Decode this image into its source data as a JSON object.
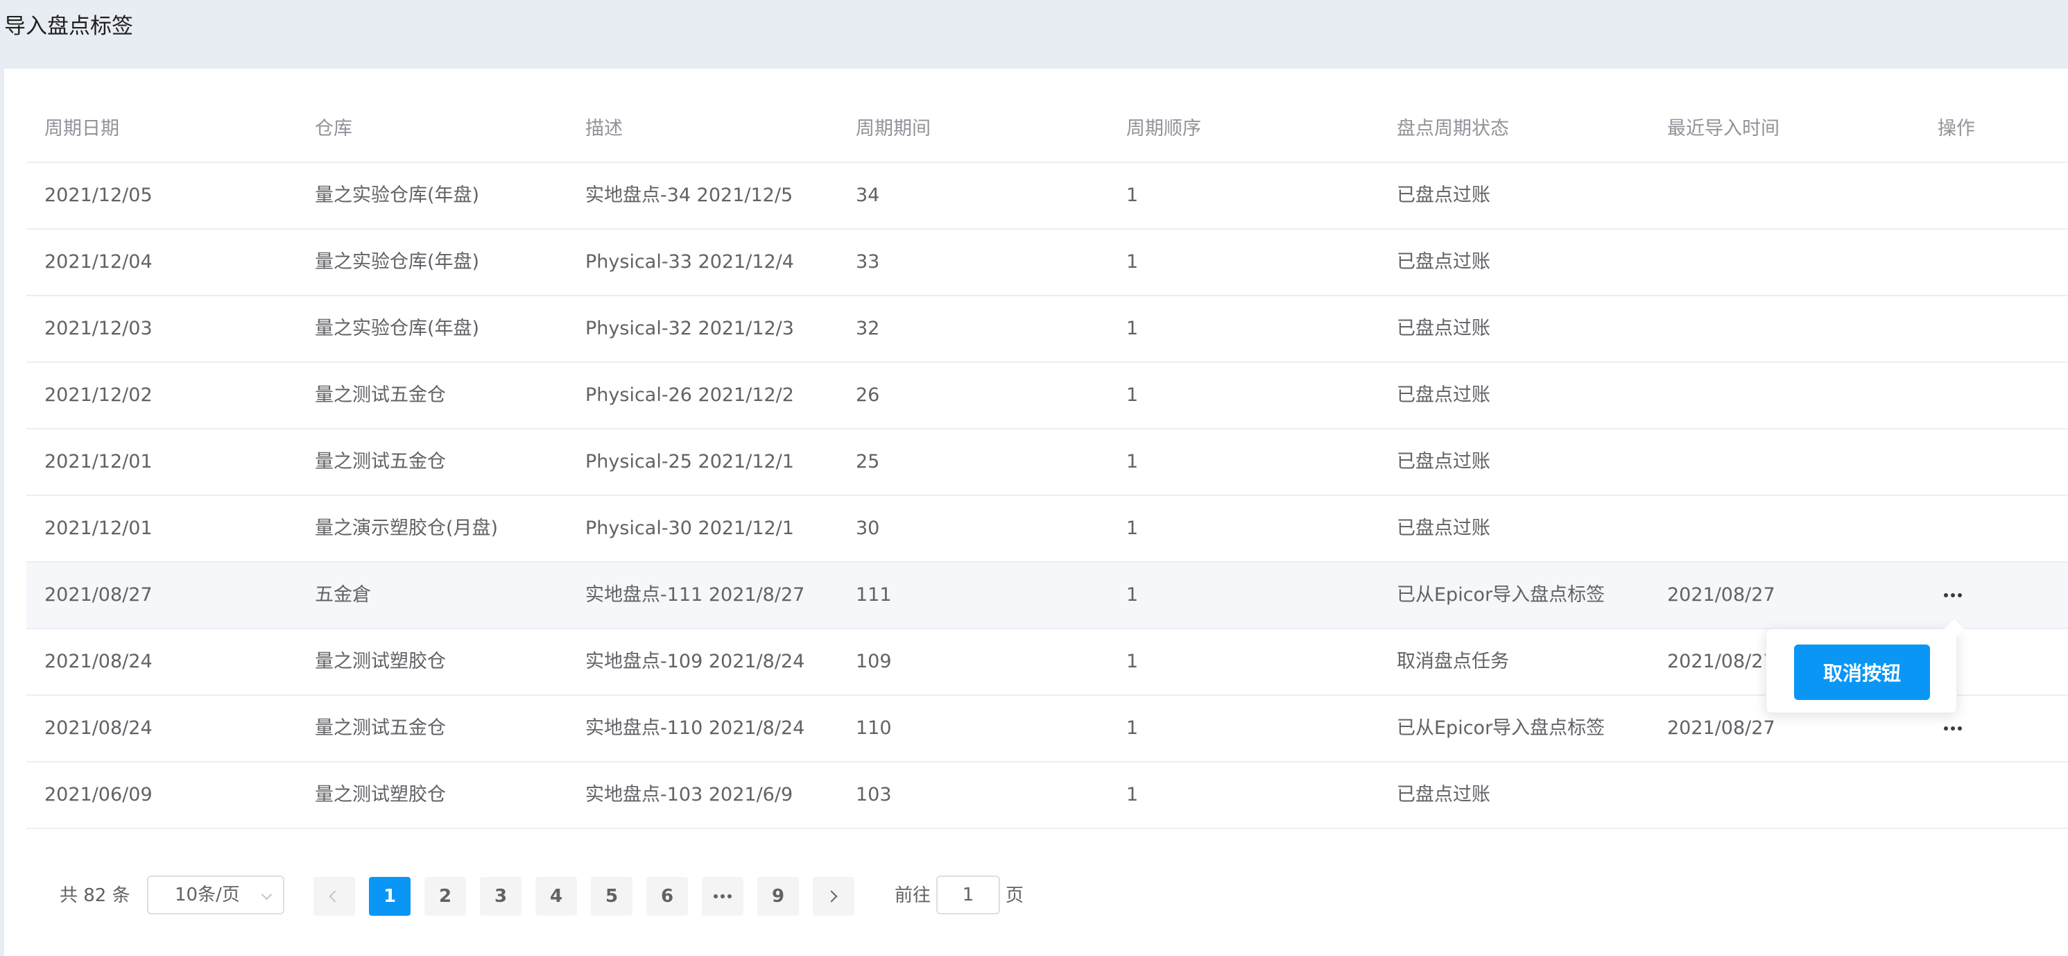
{
  "page": {
    "title": "导入盘点标签"
  },
  "table": {
    "columns": [
      "周期日期",
      "仓库",
      "描述",
      "周期期间",
      "周期顺序",
      "盘点周期状态",
      "最近导入时间",
      "操作"
    ],
    "rows": [
      {
        "date": "2021/12/05",
        "warehouse": "量之实验仓库(年盘)",
        "desc": "实地盘点-34 2021/12/5",
        "period": "34",
        "seq": "1",
        "status": "已盘点过账",
        "import_time": "",
        "has_action": false
      },
      {
        "date": "2021/12/04",
        "warehouse": "量之实验仓库(年盘)",
        "desc": "Physical-33 2021/12/4",
        "period": "33",
        "seq": "1",
        "status": "已盘点过账",
        "import_time": "",
        "has_action": false
      },
      {
        "date": "2021/12/03",
        "warehouse": "量之实验仓库(年盘)",
        "desc": "Physical-32 2021/12/3",
        "period": "32",
        "seq": "1",
        "status": "已盘点过账",
        "import_time": "",
        "has_action": false
      },
      {
        "date": "2021/12/02",
        "warehouse": "量之测试五金仓",
        "desc": "Physical-26 2021/12/2",
        "period": "26",
        "seq": "1",
        "status": "已盘点过账",
        "import_time": "",
        "has_action": false
      },
      {
        "date": "2021/12/01",
        "warehouse": "量之测试五金仓",
        "desc": "Physical-25 2021/12/1",
        "period": "25",
        "seq": "1",
        "status": "已盘点过账",
        "import_time": "",
        "has_action": false
      },
      {
        "date": "2021/12/01",
        "warehouse": "量之演示塑胶仓(月盘)",
        "desc": "Physical-30 2021/12/1",
        "period": "30",
        "seq": "1",
        "status": "已盘点过账",
        "import_time": "",
        "has_action": false
      },
      {
        "date": "2021/08/27",
        "warehouse": "五金倉",
        "desc": "实地盘点-111 2021/8/27",
        "period": "111",
        "seq": "1",
        "status": "已从Epicor导入盘点标签",
        "import_time": "2021/08/27",
        "has_action": true
      },
      {
        "date": "2021/08/24",
        "warehouse": "量之测试塑胶仓",
        "desc": "实地盘点-109 2021/8/24",
        "period": "109",
        "seq": "1",
        "status": "取消盘点任务",
        "import_time": "2021/08/27",
        "has_action": false
      },
      {
        "date": "2021/08/24",
        "warehouse": "量之测试五金仓",
        "desc": "实地盘点-110 2021/8/24",
        "period": "110",
        "seq": "1",
        "status": "已从Epicor导入盘点标签",
        "import_time": "2021/08/27",
        "has_action": true
      },
      {
        "date": "2021/06/09",
        "warehouse": "量之测试塑胶仓",
        "desc": "实地盘点-103 2021/6/9",
        "period": "103",
        "seq": "1",
        "status": "已盘点过账",
        "import_time": "",
        "has_action": false
      }
    ]
  },
  "popover": {
    "cancel_label": "取消按钮"
  },
  "pagination": {
    "total": "共 82 条",
    "page_size": "10条/页",
    "pages": [
      "1",
      "2",
      "3",
      "4",
      "5",
      "6",
      "...",
      "9"
    ],
    "current": "1",
    "goto_prefix": "前往",
    "goto_value": "1",
    "goto_suffix": "页"
  },
  "colors": {
    "accent": "#0a96f5",
    "header_bg": "#e8ecf3",
    "hover_row": "#f5f7fa"
  }
}
